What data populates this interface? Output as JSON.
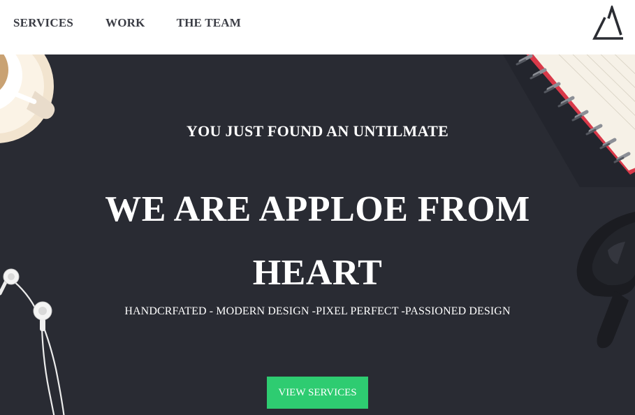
{
  "nav": {
    "links": [
      "SERVICES",
      "WORK",
      "THE TEAM"
    ],
    "logo_icon": "triangle-logo-icon"
  },
  "hero": {
    "kicker": "YOU JUST FOUND AN UNTILMATE",
    "headline": "WE ARE APPLOE FROM HEART",
    "tagline": "HANDCRFATED - MODERN DESIGN -PIXEL PERFECT -PASSIONED DESIGN",
    "cta_label": "VIEW SERVICES",
    "decor_icons": [
      "coffee-cup-icon",
      "notebook-icon",
      "eyeglasses-icon",
      "earphones-icon"
    ]
  },
  "colors": {
    "nav_bg": "#ffffff",
    "nav_text": "#3a3c44",
    "hero_bg": "#292b33",
    "accent": "#2ecc71",
    "hero_text": "#ffffff"
  }
}
